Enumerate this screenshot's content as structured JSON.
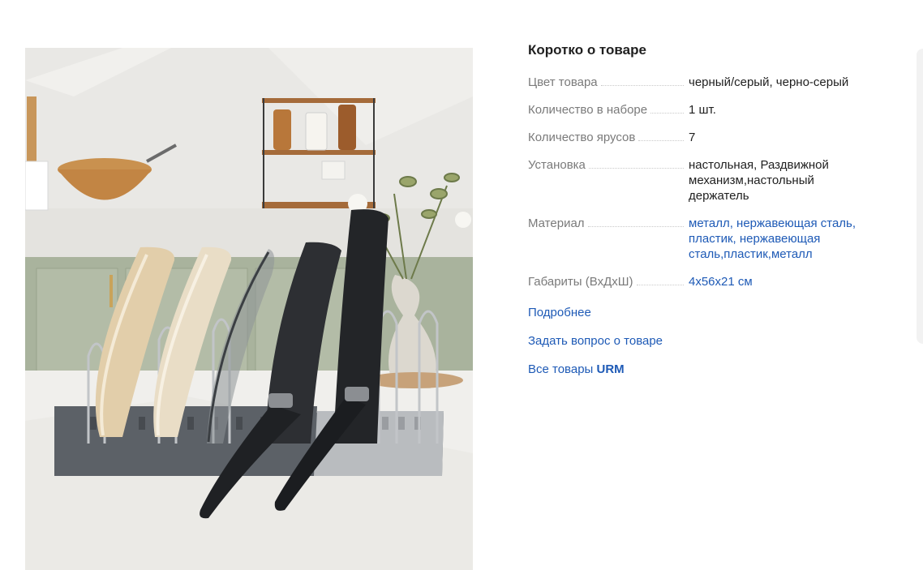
{
  "product_image": {
    "alt": "Подставка для сковородок и крышек"
  },
  "summary": {
    "title": "Коротко о товаре",
    "specs": [
      {
        "name": "Цвет товара",
        "value": "черный/серый, черно-серый",
        "is_link": false
      },
      {
        "name": "Количество в наборе",
        "value": "1 шт.",
        "is_link": false
      },
      {
        "name": "Количество ярусов",
        "value": "7",
        "is_link": false
      },
      {
        "name": "Установка",
        "value": "настольная, Раздвижной механизм,настольный держатель",
        "is_link": false
      },
      {
        "name": "Материал",
        "value": "металл, нержавеющая сталь, пластик, нержавеющая сталь,пластик,металл",
        "is_link": true
      },
      {
        "name": "Габариты (ВхДхШ)",
        "value": "4x56x21 см",
        "is_link": true
      }
    ],
    "more_link": "Подробнее",
    "ask_link": "Задать вопрос о товаре",
    "all_goods_prefix": "Все товары",
    "brand": "URM"
  },
  "colors": {
    "link": "#1e5ab6",
    "label": "#7a7a7a",
    "text": "#1f1f1f"
  }
}
